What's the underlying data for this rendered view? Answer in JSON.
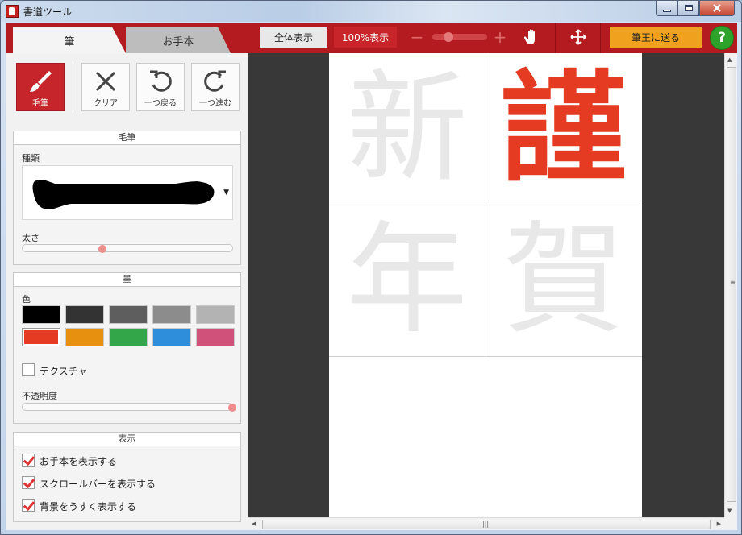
{
  "window": {
    "title": "書道ツール"
  },
  "tabs": {
    "brush": "筆",
    "model": "お手本"
  },
  "tools": [
    {
      "label": "毛筆",
      "icon": "brush-icon"
    },
    {
      "label": "クリア",
      "icon": "close-icon"
    },
    {
      "label": "一つ戻る",
      "icon": "undo-icon"
    },
    {
      "label": "一つ進む",
      "icon": "redo-icon"
    }
  ],
  "brush_section": {
    "title": "毛筆",
    "type_label": "種類",
    "size_label": "太さ",
    "size_level": 0.38
  },
  "ink_section": {
    "title": "墨",
    "color_label": "色",
    "colors": [
      "#000000",
      "#333333",
      "#5e5e5e",
      "#8c8c8c",
      "#b3b3b3",
      "#e53b22",
      "#e7900f",
      "#34a64a",
      "#2f8edb",
      "#d0527a"
    ],
    "selected_color": "#e53b22",
    "texture_label": "テクスチャ",
    "texture_checked": false,
    "opacity_label": "不透明度",
    "opacity_level": 1.0
  },
  "display_section": {
    "title": "表示",
    "options": [
      {
        "label": "お手本を表示する",
        "checked": true
      },
      {
        "label": "スクロールバーを表示する",
        "checked": true
      },
      {
        "label": "背景をうすく表示する",
        "checked": true
      }
    ]
  },
  "toolbar": {
    "fit_label": "全体表示",
    "zoom_label": "100%表示",
    "zoom_level": 0.3,
    "send_label": "筆王に送る",
    "help_label": "?"
  },
  "canvas": {
    "model_chars": [
      "新",
      "謹",
      "年",
      "賀"
    ],
    "written_char": "謹",
    "ink_color": "#e53b22"
  }
}
